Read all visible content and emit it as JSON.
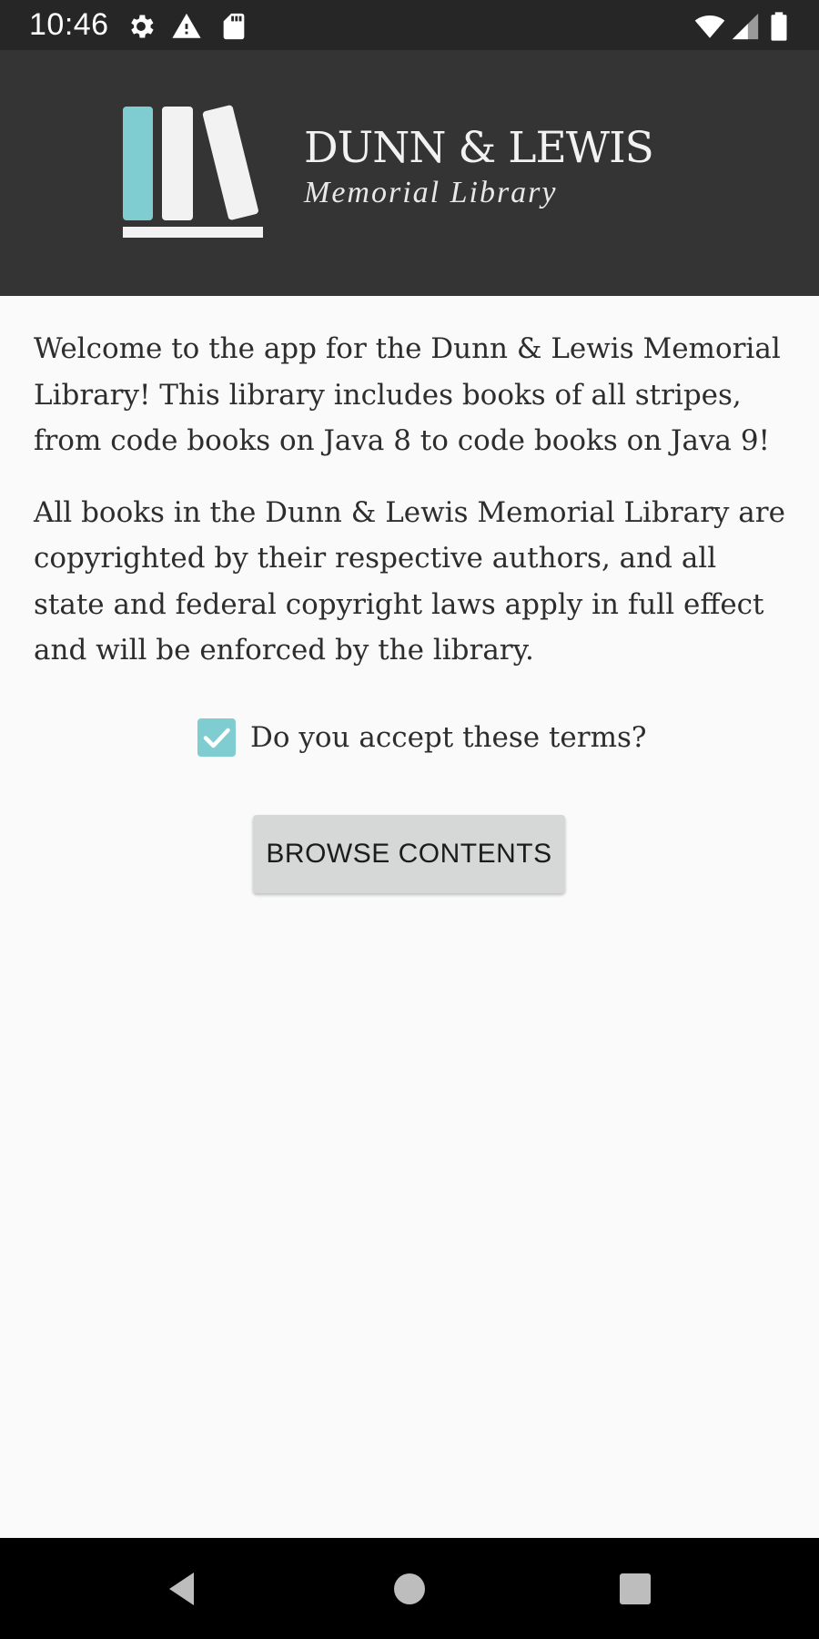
{
  "status_bar": {
    "time": "10:46",
    "icons": [
      "gear-icon",
      "warning-icon",
      "sd-card-icon",
      "wifi-icon",
      "cell-signal-icon",
      "battery-icon"
    ]
  },
  "banner": {
    "logo_title": "DUNN & LEWIS",
    "logo_subtitle": "Memorial Library",
    "accent_color": "#7fcdd0",
    "background_color": "#343434"
  },
  "content": {
    "paragraph_1": "Welcome to the app for the Dunn & Lewis Memorial Library! This library includes books of all stripes, from code books on Java 8 to code books on Java 9!",
    "paragraph_2": "All books in the Dunn & Lewis Memorial Library are copyrighted by their respective authors, and all state and federal copyright laws apply in full effect and will be enforced by the library.",
    "terms_label": "Do you accept these terms?",
    "terms_checked": true,
    "browse_button_label": "BROWSE CONTENTS"
  },
  "nav_bar": {
    "buttons": [
      "back-icon",
      "home-icon",
      "recents-icon"
    ]
  }
}
